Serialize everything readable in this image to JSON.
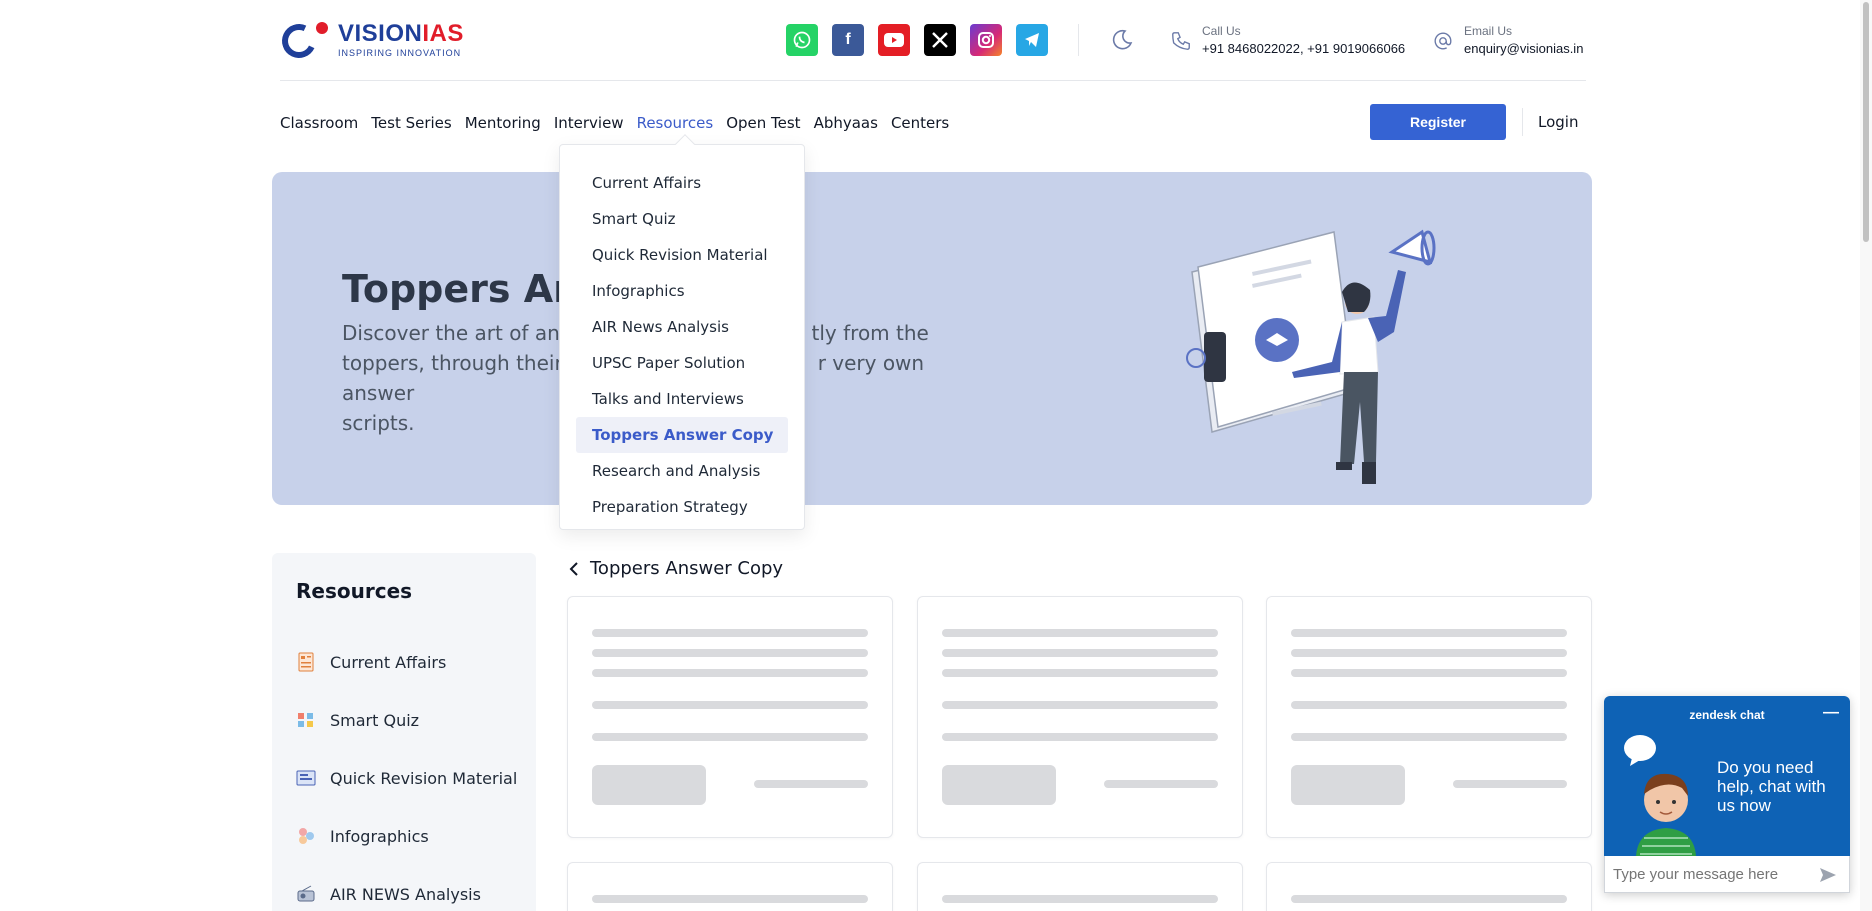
{
  "brand": {
    "name_main": "VISION",
    "name_accent": "IAS",
    "tagline": "INSPIRING INNOVATION"
  },
  "socials": [
    "whatsapp-icon",
    "facebook-icon",
    "youtube-icon",
    "x-icon",
    "instagram-icon",
    "telegram-icon"
  ],
  "contact": {
    "call_label": "Call Us",
    "call_value": "+91 8468022022, +91 9019066066",
    "email_label": "Email Us",
    "email_value": "enquiry@visionias.in"
  },
  "nav": {
    "items": [
      "Classroom",
      "Test Series",
      "Mentoring",
      "Interview",
      "Resources",
      "Open Test",
      "Abhyaas",
      "Centers"
    ],
    "active": "Resources",
    "register_label": "Register",
    "login_label": "Login"
  },
  "dropdown": {
    "items": [
      "Current Affairs",
      "Smart Quiz",
      "Quick Revision Material",
      "Infographics",
      "AIR News Analysis",
      "UPSC Paper Solution",
      "Talks and Interviews",
      "Toppers Answer Copy",
      "Research and Analysis",
      "Preparation Strategy"
    ],
    "selected": "Toppers Answer Copy"
  },
  "hero": {
    "title": "Toppers Ans",
    "desc_line1": "Discover the art of answ",
    "desc_line1_right": "tly from the",
    "desc_line2": "toppers, through their",
    "desc_line2_right": "r very own answer",
    "desc_line3": "scripts."
  },
  "sidebar": {
    "title": "Resources",
    "items": [
      "Current Affairs",
      "Smart Quiz",
      "Quick Revision Material",
      "Infographics",
      "AIR NEWS Analysis"
    ]
  },
  "breadcrumb": {
    "label": "Toppers Answer Copy"
  },
  "chat": {
    "title": "zendesk chat",
    "message": "Do you need help, chat with us now",
    "placeholder": "Type your message here"
  },
  "colors": {
    "accent": "#3563d3",
    "hero_bg": "#c7d1ea",
    "chat_bg": "#0e62b5"
  }
}
